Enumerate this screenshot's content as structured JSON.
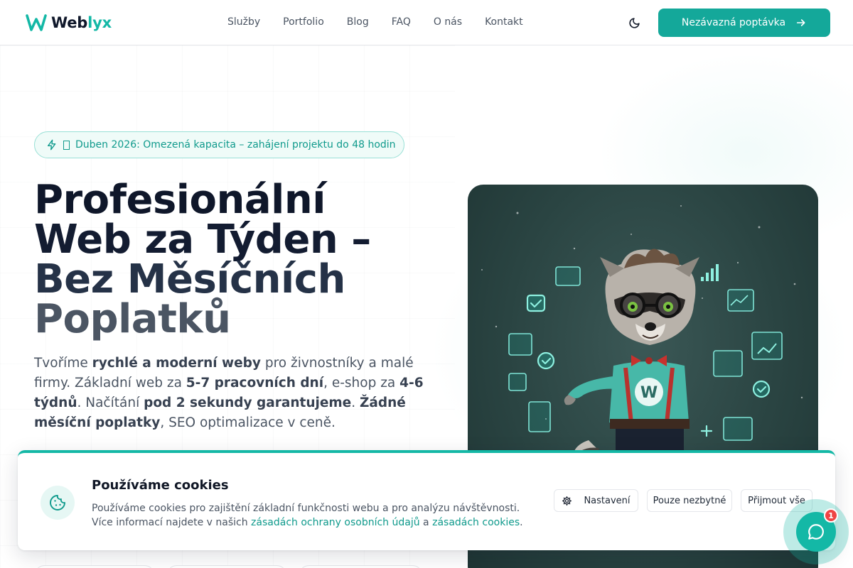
{
  "header": {
    "logo_text_main": "Web",
    "logo_text_accent": "lyx",
    "nav": [
      "Služby",
      "Portfolio",
      "Blog",
      "FAQ",
      "O nás",
      "Kontakt"
    ],
    "cta_label": "Nezávazná poptávka"
  },
  "hero": {
    "badge_text": "Duben 2026: Omezená kapacita – zahájení projektu do 48 hodin",
    "title_lines": [
      "Profesionální",
      "Web za Týden –",
      "Bez Měsíčních",
      "Poplatků"
    ],
    "description": {
      "p1": "Tvoříme ",
      "b1": "rychlé a moderní weby",
      "p2": " pro živnostníky a malé firmy. Základní web za ",
      "b2": "5-7 pracovních dní",
      "p3": ", e-shop za ",
      "b3": "4-6 týdnů",
      "p4": ". Načítání ",
      "b4": "pod 2 sekundy garantujeme",
      "p5": ". ",
      "b5": "Žádné měsíční poplatky",
      "p6": ", SEO optimalizace v ceně."
    },
    "image_mascot_letter": "W"
  },
  "cookie": {
    "title": "Používáme cookies",
    "text_line1": "Používáme cookies pro zajištění základní funkčnosti webu a pro analýzu návštěvnosti.",
    "text_line2_prefix": "Více informací najdete v našich ",
    "link_privacy": "zásadách ochrany osobních údajů",
    "text_and": " a ",
    "link_cookies": "zásadách cookies",
    "text_end": ".",
    "btn_settings": "Nastavení",
    "btn_necessary": "Pouze nezbytné",
    "btn_accept": "Přijmout vše"
  },
  "chat": {
    "badge_count": "1"
  },
  "colors": {
    "accent": "#14b8a6",
    "accent_dark": "#14a89a",
    "heading": "#0f172a",
    "badge_red": "#ef4444"
  }
}
